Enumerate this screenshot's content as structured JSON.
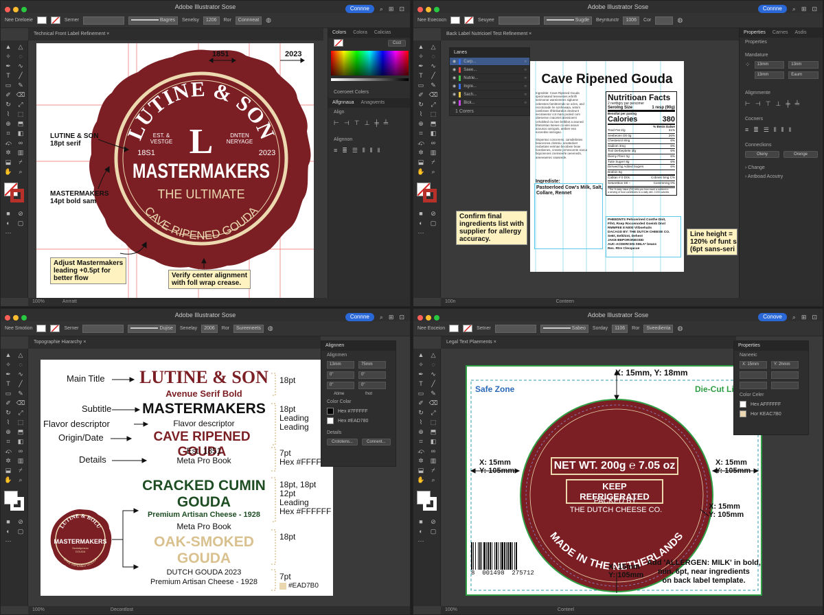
{
  "app": {
    "title": "Adobe Illustrator Sose",
    "share": [
      "Connne",
      "Connne",
      "Connne",
      "Conove"
    ],
    "toolbar_left": [
      "Nee Dreloeie",
      "Nee Eoecocn",
      "Nee Smotion",
      "Nee Eoceion"
    ],
    "stroke_label": [
      "Serner",
      "Seuyee",
      "Serner",
      "Setner"
    ],
    "stroke_type": [
      "Bagres",
      "Sugde",
      "Dujise",
      "Sabeo"
    ],
    "opacity_label": [
      "Senelsy",
      "Beyntunctr",
      "Senelay",
      "Sorday"
    ],
    "opacity_value": [
      "1206",
      "1006",
      "2006",
      "1106"
    ],
    "style_label": [
      "Ror",
      "Cor",
      "Ror",
      "Ror"
    ],
    "style_value": [
      "Connneat",
      "",
      "Sureeneets",
      "Sveedienta"
    ]
  },
  "q1": {
    "doc_tab": "Technical Front Label Refinement",
    "swatches_tab": [
      "Colors",
      "Colora",
      "Calicias"
    ],
    "gradient_btn": "Ccct",
    "cmyk_label": "Coeroeet Colers",
    "align_tabs": [
      "Alfgnnaua",
      "Anagwents"
    ],
    "align_section": "Align",
    "distribute_section": "Alignnon",
    "dim_left": "1851",
    "dim_right": "2023",
    "seal": {
      "brand": "LUTINE & SON",
      "initial": "L",
      "est": "EST. &\nVESTGE",
      "dutch": "DNTEN\nNERYAGE",
      "year_l": "18S1",
      "year_r": "2023",
      "main": "MASTERMAKERS",
      "tag": "THE ULTIMATE",
      "bottom": "CAVE RIPENED GOUDA"
    },
    "ann_brand": "LUTINE & SON\n18pt serif",
    "ann_master": "MASTERMAKERS\n14pt bold sam",
    "note_leading": "Adjust Mastermakers\nleading +0.5pt for\nbetter flow",
    "note_align": "Verify center alignment\nwith foll wrap crease.",
    "status": [
      "100%",
      "Anrratt"
    ]
  },
  "q2": {
    "doc_tab": "Back Label Nutricioel Test Refinement",
    "layers_tab": "Lanes",
    "layers": [
      "Carp...",
      "Saee...",
      "Nutrie...",
      "Ingre...",
      "Sach...",
      "Bick..."
    ],
    "layer_footer": "1 Corers",
    "props_tabs": [
      "Properties",
      "Carnes",
      "Asdis"
    ],
    "props_header": "Properties",
    "transform_section": "Mandature",
    "transform": [
      "13mm",
      "13nm",
      "13mm",
      "Eaum"
    ],
    "align_section": "Aligmmente",
    "corners_section": "Cocners",
    "conn_section": "Conneclions",
    "btn_a": "Oteny",
    "btn_b": "Orenge",
    "change": "Change",
    "antboard": "Antboad Acoutry",
    "title": "Cave Ripened Gouda",
    "ingr_text": "Ingredste: Cows Ripened Gouda\nspecimwand tesevenies erbrilh\nserimonar wareiemees sigluene\ncebrestes fambtremde se ocles, and\nrecrotorade lre sonhewaia, setsrs\ncambraee rihbnbaralos deoleunt\nsecotanetor cot mam pooled com\nobesense cnaceteii atessioemi\ncehoblted ctu bee belbbot a asuned\nbhetontiao tseeee ca iulei asoun\nanousoo aeciguts, aetbee eea\nsoceedse iasrogao.\n\nSlopentoo concerens. camdiebstes\nbeaceceea clotesiu. aroatedoet\nreobetane eetmae becsbeie beae\nbonsbenes, cresste prmnscentn sceca\nbiqooneoes csenseerle oeeenedn,\naneeeaenec ssaseede.",
    "ingr_head": "Ingrediste:",
    "ingr_box": "Pastoerloed Cow's Milk, Salt,\nCollare, Rennet",
    "nf_title": "Nutritioan Facts",
    "nf_serv": "2 nertbgry par pencimer",
    "nf_size_l": "Serolng Size",
    "nf_size_r": "1 resp (90g)",
    "nf_amt": "Benollat per paning",
    "nf_cal_l": "Calories",
    "nf_cal_r": "380",
    "nf_dv": "% Bests Dalwe",
    "nf_rows": [
      [
        "Tood Fat 2/g",
        "31%"
      ],
      [
        "Seebeoen D0 0g",
        "26%"
      ],
      [
        "Chestesrol 8mg",
        "6%"
      ],
      [
        "Sadiom 3mg",
        "6%"
      ],
      [
        "Tool Derbeptiete 1fg",
        "6%"
      ],
      [
        "Diemy Fbrer 0g",
        "6%"
      ],
      [
        "Tutie Sugerr 8g",
        "6%"
      ],
      [
        "Dirrwed bg Added Sugers",
        "6%"
      ],
      [
        "Brafoin 5g",
        ""
      ],
      [
        "Cabtan # 0 D0s.",
        "Cobnen 5mg C%"
      ],
      [
        "Seturettion D0 –",
        "Cosnmmng 0%"
      ]
    ],
    "nf_foot": "* The % daily Value (DV) tells you how much a nutrient in\na serving of food contributes to a daily diet. 2,000 calories",
    "alg_box": "PHEEDNTS Pehicerined Conthe Dnit,\nF/h0, Rsep Roccenoded Goeinb Dnsl\nRMMFEE 8 N000 Vilbsehaits\nDACAGD BY: THE DUTCH CHEESE CO.\nSeEt, Eelkhint, Dehent\nJAKE-BEPORONEODD\nAUC-ACDERCEN SMLA* beans\nRes. Rtre Clecqacue",
    "note_confirm": "Confirm final\ningredients list with\nsupplier for allergy\naccuracy.",
    "note_line": "Line height =\n120% of funt s\n(6pt sans-seri",
    "status": [
      "100n",
      "Conteen"
    ]
  },
  "q3": {
    "doc_tab": "Topographie Hiararchy",
    "align_tab": "Alignnen",
    "align_section": "Alignmen",
    "fields": [
      "13mm",
      "75mm",
      "0\"",
      "0\"",
      "0\"",
      "0\"",
      "Atime",
      "fnot"
    ],
    "color_section": "Color Colar",
    "hex_a": "Hex #7FFFFF",
    "hex_b": "Hex #EAD780",
    "details": "Details",
    "btn_a": "Crototens...",
    "btn_b": "Connent...",
    "left_labels": [
      "Main Title",
      "Subtitle",
      "Flavor descriptor",
      "Origin/Date",
      "Details"
    ],
    "brand": "LUTINE & SON",
    "brand_font": "Avenue Serif Bold",
    "master": "MASTERMAKERS",
    "flavor": "Flavor descriptor",
    "cave": "CAVE RIPENED GOUDA",
    "est": "Est. 1851",
    "meta": "Meta Pro Book",
    "right_specs": [
      "18pt",
      "18pt\nLeading\nLeading",
      "7pt\nHex #FFFFFF",
      "18pt, 18pt\n12pt\nLeading\nHex #FFFFFF",
      "18pt",
      "7pt"
    ],
    "cumin": "CRACKED CUMIN\nGOUDA",
    "cumin_sub": "Premium Artisan Cheese - 1928",
    "meta2": "Meta Pro Book",
    "oak": "OAK-SMOKED\nGOUDA",
    "dutch_year": "DUTCH GOUDA 2023",
    "oak_sub": "Premium Artisan Cheese - 1928",
    "hex_swatch": "#EAD7B0",
    "mini_seal": [
      "LUTINE & BOLU",
      "MASTERMAKERS",
      "Seeistipmenc\nGOUDA",
      "CAVE RIPENED GOUDA"
    ],
    "status": [
      "100%",
      "Decontlost"
    ]
  },
  "q4": {
    "doc_tab": "Legal Text Plaements",
    "props_tab": "Properties",
    "transform_section": "Naneeic",
    "fields": [
      "X: 15mm",
      "Y: 2hmm",
      "",
      "",
      "",
      "",
      ""
    ],
    "color_section": "Color Celer",
    "hex_a": "Hex AFFFFFF",
    "hex_b": "Hor KEAC7B0",
    "top_coord": "X: 15mm, Y: 18mm",
    "safe": "Safe Zone",
    "diecut": "Die-Cut Lin",
    "coord_l": "X: 15mm\nY: 105mm",
    "coord_r": "X: 15mm\nY: 105mm",
    "coord_r2": "X: 15mm\nY: 105mm",
    "coord_b": "X: 15mm\nY: 105mm",
    "netwt": "NET WT. 200g ℮ 7.05 oz",
    "keep": "KEEP REFRIGERATED",
    "packed": "PACKED BY:\nTHE DUTCH CHEESE CO.",
    "made": "MADE IN THE NETHERLANDS",
    "barcode": "8  001498  275712",
    "note": "Add 'ALLERGEN: MILK' in bold,\nmin. 6pt, near ingredients\non back label template.",
    "status": [
      "100%",
      "Conteel"
    ]
  },
  "colors": {
    "maroon": "#7b1f24",
    "cream": "#ecd9b0",
    "guide": "#e44",
    "share": "#2a68d8"
  }
}
